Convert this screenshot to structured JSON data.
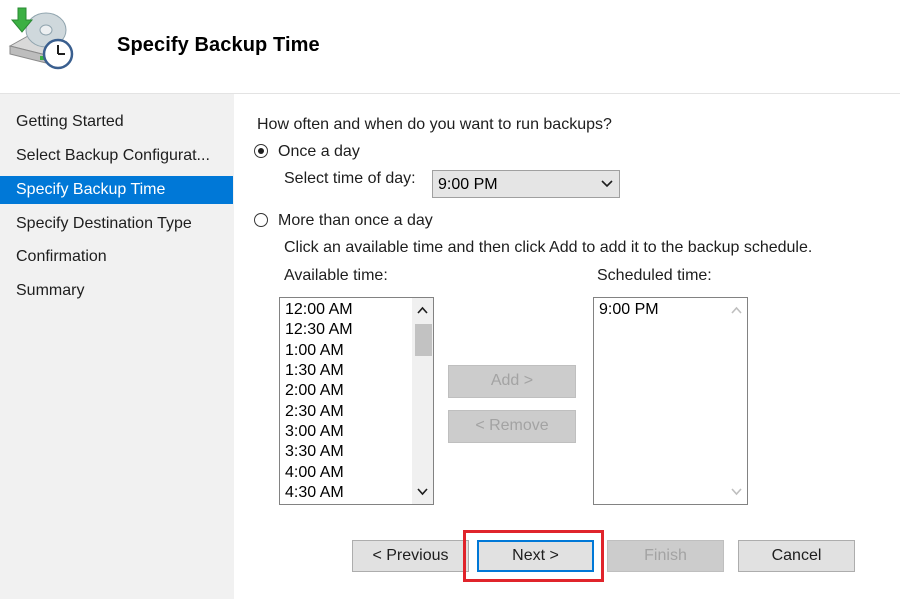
{
  "header": {
    "title": "Specify Backup Time",
    "icon": "backup-disk-clock-icon"
  },
  "sidebar": {
    "items": [
      {
        "label": "Getting Started",
        "active": false
      },
      {
        "label": "Select Backup Configurat...",
        "active": false
      },
      {
        "label": "Specify Backup Time",
        "active": true
      },
      {
        "label": "Specify Destination Type",
        "active": false
      },
      {
        "label": "Confirmation",
        "active": false
      },
      {
        "label": "Summary",
        "active": false
      }
    ]
  },
  "main": {
    "question": "How often and when do you want to run backups?",
    "option_once": {
      "label": "Once a day",
      "selected": true
    },
    "select_time_label": "Select time of day:",
    "select_time_value": "9:00 PM",
    "option_more": {
      "label": "More than once a day",
      "selected": false
    },
    "instruction": "Click an available time and then click Add to add it to the backup schedule.",
    "available_label": "Available time:",
    "available_times": [
      "12:00 AM",
      "12:30 AM",
      "1:00 AM",
      "1:30 AM",
      "2:00 AM",
      "2:30 AM",
      "3:00 AM",
      "3:30 AM",
      "4:00 AM",
      "4:30 AM"
    ],
    "scheduled_label": "Scheduled time:",
    "scheduled_times": [
      "9:00 PM"
    ],
    "add_button": "Add >",
    "remove_button": "< Remove"
  },
  "footer": {
    "previous": "< Previous",
    "next": "Next >",
    "finish": "Finish",
    "cancel": "Cancel"
  },
  "colors": {
    "accent": "#0078d7",
    "highlight": "#e0242b",
    "sidebar_bg": "#f1f1f1"
  }
}
